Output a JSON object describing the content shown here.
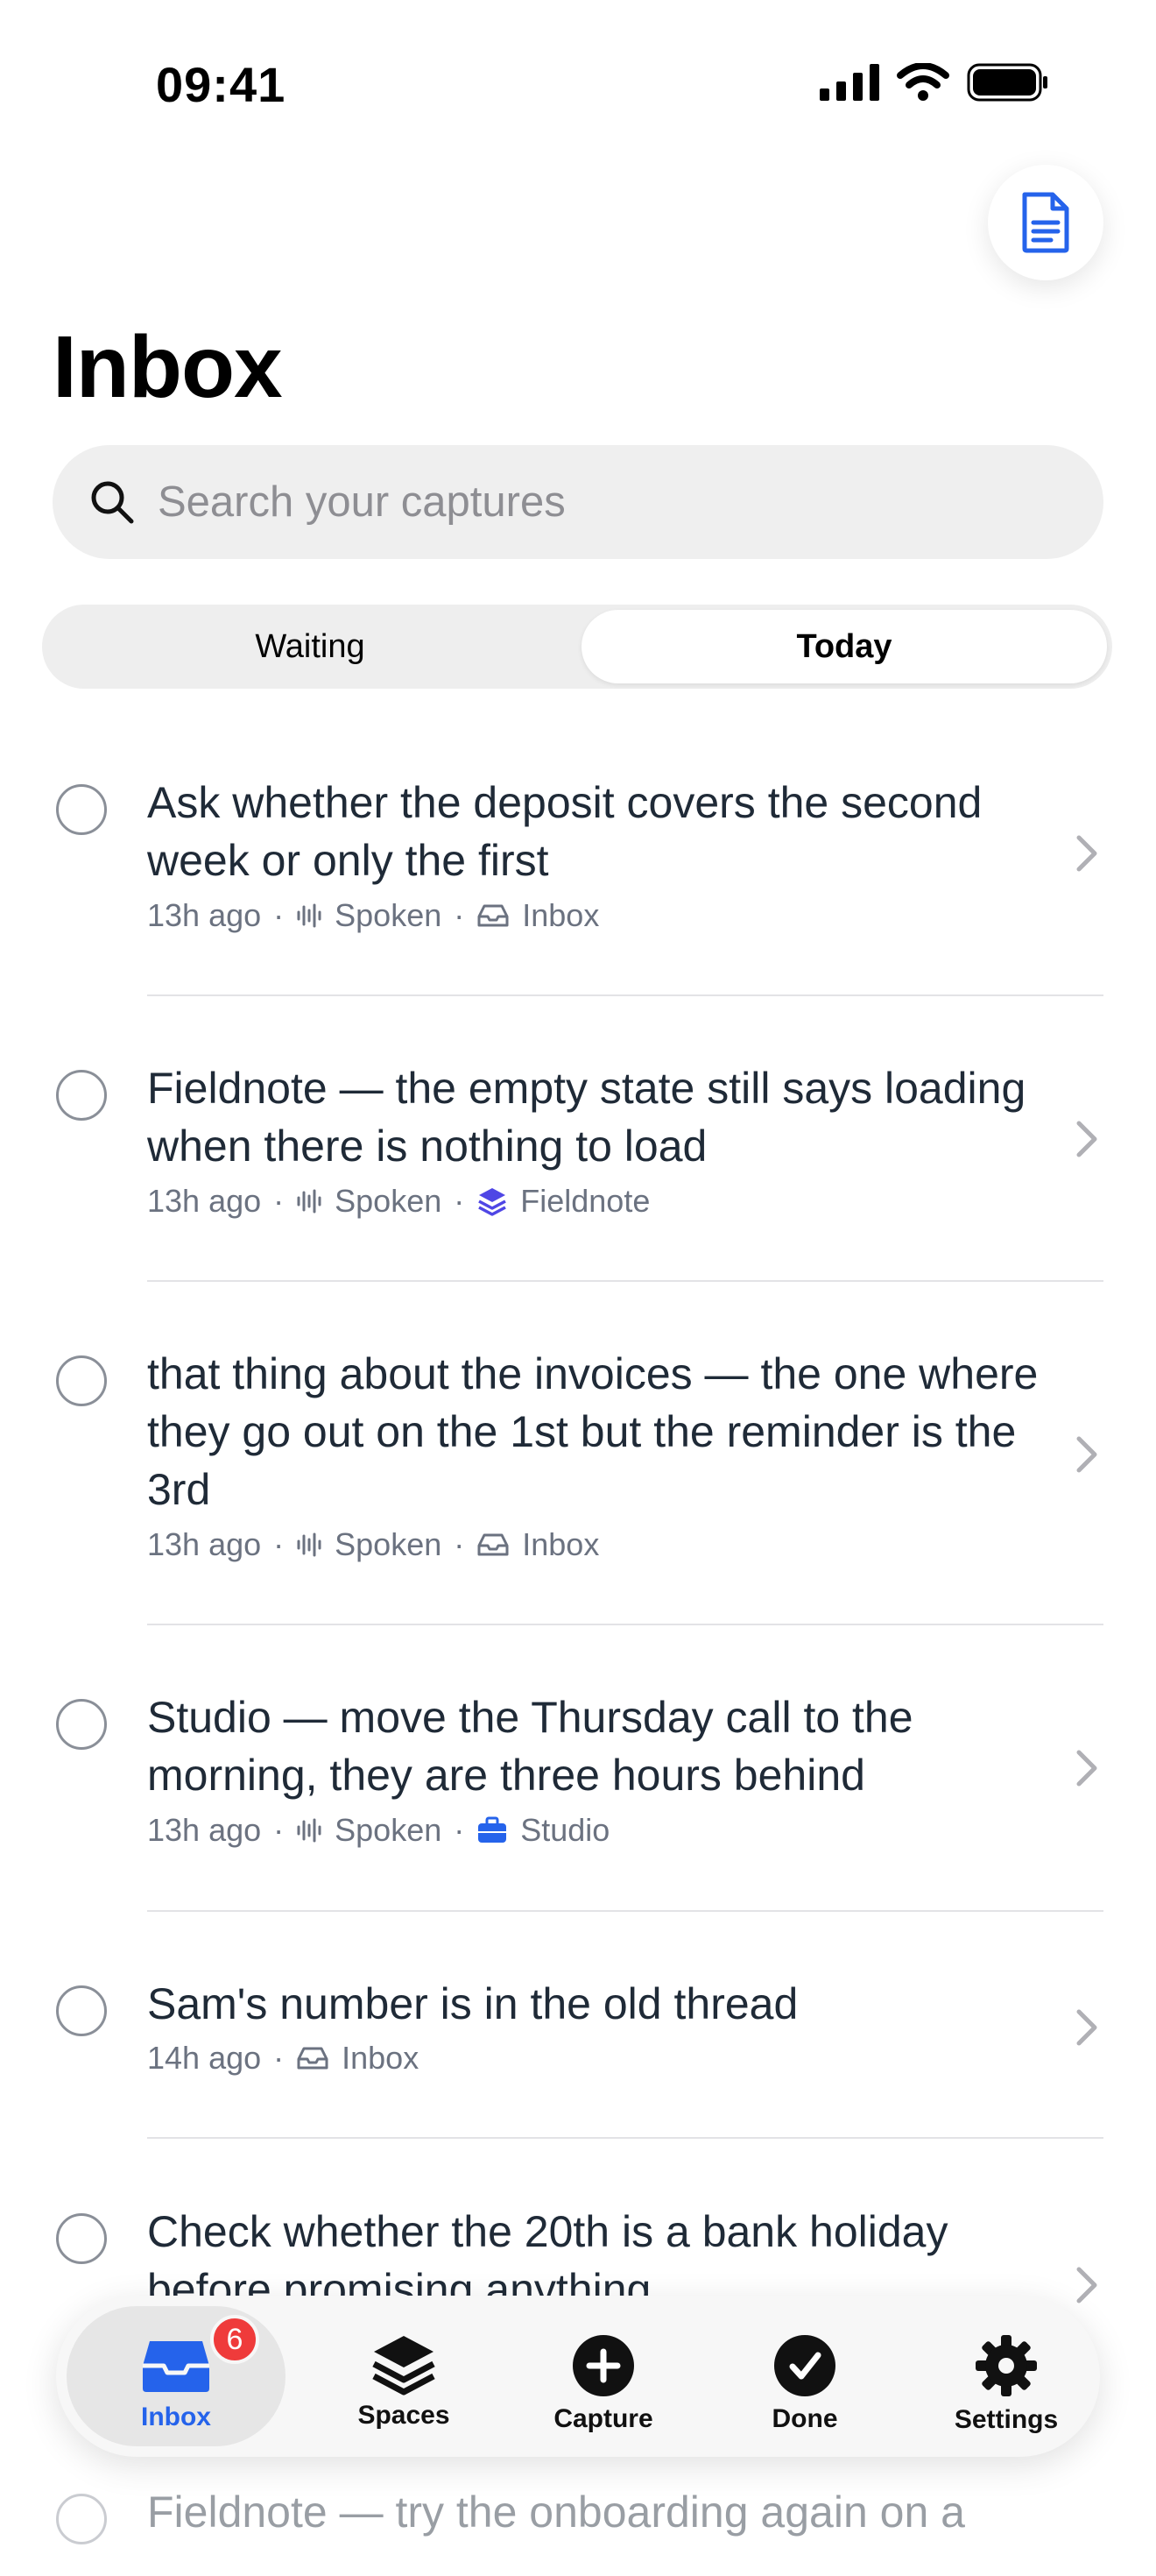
{
  "status": {
    "time": "09:41"
  },
  "header": {
    "title": "Inbox"
  },
  "search": {
    "placeholder": "Search your captures"
  },
  "segments": [
    "Waiting",
    "Today"
  ],
  "items": [
    {
      "title": "Ask whether the deposit covers the second week or only the first",
      "time": "13h ago",
      "source": "Spoken",
      "space": "Inbox",
      "space_icon": "inbox-tray-icon"
    },
    {
      "title": "Fieldnote — the empty state still says loading when there is nothing to load",
      "time": "13h ago",
      "source": "Spoken",
      "space": "Fieldnote",
      "space_icon": "layers-icon"
    },
    {
      "title": "that thing about the invoices — the one where they go out on the 1st but the reminder is the 3rd",
      "time": "13h ago",
      "source": "Spoken",
      "space": "Inbox",
      "space_icon": "inbox-tray-icon"
    },
    {
      "title": "Studio — move the Thursday call to the morning, they are three hours behind",
      "time": "13h ago",
      "source": "Spoken",
      "space": "Studio",
      "space_icon": "briefcase-icon"
    },
    {
      "title": "Sam's number is in the old thread",
      "time": "14h ago",
      "space": "Inbox",
      "space_icon": "inbox-tray-icon"
    },
    {
      "title": "Check whether the 20th is a bank holiday before promising anything",
      "time": "",
      "source": "",
      "space": ""
    },
    {
      "title": "Fieldnote — try the onboarding again on a"
    }
  ],
  "tabbar": {
    "inbox": "Inbox",
    "inbox_badge": "6",
    "spaces": "Spaces",
    "capture": "Capture",
    "done": "Done",
    "settings": "Settings"
  },
  "colors": {
    "accent": "#2563eb",
    "badge": "#ef3b3b",
    "fieldnote": "#4f46e5",
    "studio": "#2563eb"
  }
}
